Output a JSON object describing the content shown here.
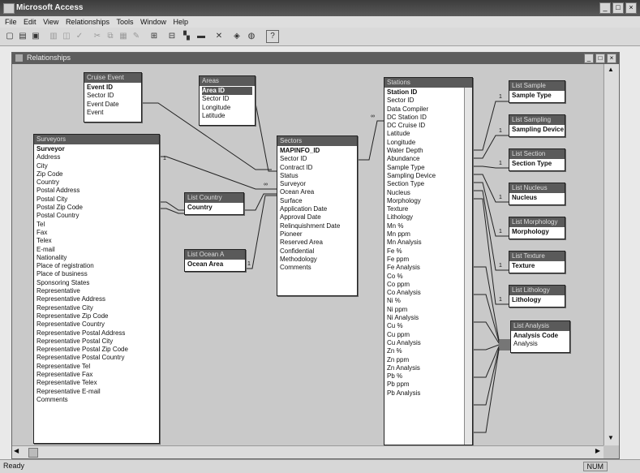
{
  "window": {
    "title": "Microsoft Access",
    "controls": [
      "_",
      "□",
      "×"
    ]
  },
  "menu": [
    "File",
    "Edit",
    "View",
    "Relationships",
    "Tools",
    "Window",
    "Help"
  ],
  "toolbar": {
    "icons": [
      "new-icon",
      "open-icon",
      "save-icon",
      "print-icon",
      "preview-icon",
      "spell-icon",
      "cut-icon",
      "copy-icon",
      "paste-icon",
      "format-painter-icon",
      "show-table-icon",
      "show-direct-icon",
      "show-all-icon",
      "clear-layout-icon",
      "delete-icon",
      "database-window-icon",
      "new-object-icon",
      "help-icon"
    ]
  },
  "relwin": {
    "title": "Relationships"
  },
  "tables": {
    "cruise": {
      "title": "Cruise Event",
      "fields": [
        "Event ID",
        "Sector ID",
        "Event Date",
        "Event"
      ],
      "keys": [
        0
      ]
    },
    "areas": {
      "title": "Areas",
      "fields": [
        "Area ID",
        "Sector ID",
        "Longitude",
        "Latitude"
      ],
      "keys": [
        0
      ]
    },
    "surveyors": {
      "title": "Surveyors",
      "fields": [
        "Surveyor",
        "Address",
        "City",
        "Zip Code",
        "Country",
        "Postal Address",
        "Postal City",
        "Postal Zip Code",
        "Postal Country",
        "Tel",
        "Fax",
        "Telex",
        "E-mail",
        "Nationality",
        "Place of registration",
        "Place of business",
        "Sponsoring States",
        "Representative",
        "Representative Address",
        "Representative City",
        "Representative Zip Code",
        "Representative Country",
        "Representative Postal Address",
        "Representative Postal City",
        "Representative Postal Zip Code",
        "Representative Postal Country",
        "Representative Tel",
        "Representative Fax",
        "Representative Telex",
        "Representative E-mail",
        "Comments"
      ],
      "keys": [
        0
      ]
    },
    "sectors": {
      "title": "Sectors",
      "fields": [
        "MAPINFO_ID",
        "Sector ID",
        "Contract ID",
        "Status",
        "Surveyor",
        "Ocean Area",
        "Surface",
        "Application Date",
        "Approval Date",
        "Relinquishment Date",
        "Pioneer",
        "Reserved Area",
        "Confidential",
        "Methodology",
        "Comments"
      ],
      "keys": [
        0
      ]
    },
    "country": {
      "title": "List Country",
      "fields": [
        "Country"
      ],
      "keys": [
        0
      ]
    },
    "ocean": {
      "title": "List Ocean A",
      "fields": [
        "Ocean Area"
      ],
      "keys": [
        0
      ]
    },
    "stations": {
      "title": "Stations",
      "fields": [
        "Station ID",
        "Sector ID",
        "Data Compiler",
        "DC Station ID",
        "DC Cruise ID",
        "Latitude",
        "Longitude",
        "Water Depth",
        "Abundance",
        "Sample Type",
        "Sampling Device",
        "Section Type",
        "Nucleus",
        "Morphology",
        "Texture",
        "Lithology",
        "Mn %",
        "Mn ppm",
        "Mn Analysis",
        "Fe %",
        "Fe ppm",
        "Fe Analysis",
        "Co %",
        "Co ppm",
        "Co Analysis",
        "Ni %",
        "Ni ppm",
        "Ni Analysis",
        "Cu %",
        "Cu ppm",
        "Cu Analysis",
        "Zn %",
        "Zn ppm",
        "Zn Analysis",
        "Pb %",
        "Pb ppm",
        "Pb Analysis"
      ],
      "keys": [
        0
      ]
    },
    "sample": {
      "title": "List Sample",
      "fields": [
        "Sample Type"
      ],
      "keys": [
        0
      ]
    },
    "device": {
      "title": "List Sampling",
      "fields": [
        "Sampling Device"
      ],
      "keys": [
        0
      ]
    },
    "section": {
      "title": "List Section",
      "fields": [
        "Section Type"
      ],
      "keys": [
        0
      ]
    },
    "nucleus": {
      "title": "List Nucleus",
      "fields": [
        "Nucleus"
      ],
      "keys": [
        0
      ]
    },
    "morph": {
      "title": "List Morphology",
      "fields": [
        "Morphology"
      ],
      "keys": [
        0
      ]
    },
    "texture": {
      "title": "List Texture",
      "fields": [
        "Texture"
      ],
      "keys": [
        0
      ]
    },
    "litho": {
      "title": "List Lithology",
      "fields": [
        "Lithology"
      ],
      "keys": [
        0
      ]
    },
    "analysis": {
      "title": "List Analysis",
      "fields": [
        "Analysis Code",
        "Analysis"
      ],
      "keys": [
        0
      ]
    }
  },
  "cardinality": {
    "one": "1",
    "many": "∞"
  },
  "status": {
    "left": "Ready",
    "right": "NUM"
  }
}
